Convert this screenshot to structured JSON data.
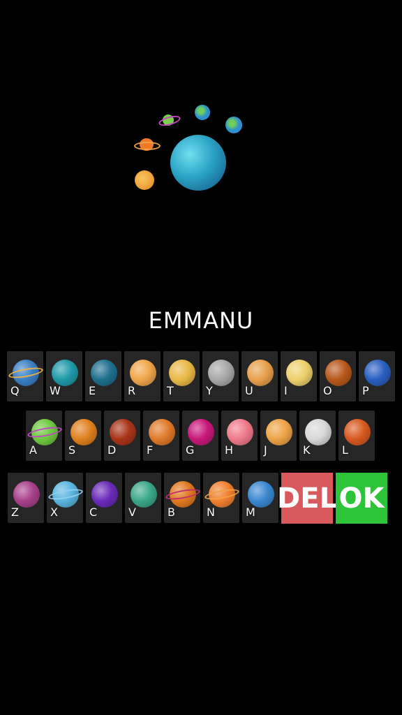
{
  "entered_name": "EMMANU",
  "scene_planets": [
    {
      "name": "large-blue-planet-icon",
      "color": "#2aa3c4"
    },
    {
      "name": "ringed-green-planet-icon",
      "color": "#7ccf4a"
    },
    {
      "name": "earth-small-1-icon",
      "color": "#2f8fd0"
    },
    {
      "name": "earth-small-2-icon",
      "color": "#2f8fd0"
    },
    {
      "name": "ringed-orange-planet-icon",
      "color": "#f07a2a"
    },
    {
      "name": "orange-planet-icon",
      "color": "#f2a640"
    }
  ],
  "keyboard": {
    "row1": [
      {
        "letter": "Q",
        "icon": "ringed-planet-icon",
        "color": "#3b7fc4",
        "ring": "#e9b04a"
      },
      {
        "letter": "W",
        "icon": "teal-planet-icon",
        "color": "#1f9aa8"
      },
      {
        "letter": "E",
        "icon": "blue-planet-icon",
        "color": "#1f6f8e"
      },
      {
        "letter": "R",
        "icon": "orange-moon-planet-icon",
        "color": "#f0a64a"
      },
      {
        "letter": "T",
        "icon": "yellow-striped-planet-icon",
        "color": "#e9b847"
      },
      {
        "letter": "Y",
        "icon": "gray-moon-icon",
        "color": "#a8a8a8"
      },
      {
        "letter": "U",
        "icon": "orange-blue-planet-icon",
        "color": "#e8a04c"
      },
      {
        "letter": "I",
        "icon": "yellow-planet-icon",
        "color": "#ecd06a"
      },
      {
        "letter": "O",
        "icon": "brown-cracked-planet-icon",
        "color": "#b8581c"
      },
      {
        "letter": "P",
        "icon": "deep-blue-planet-icon",
        "color": "#2a5fc0"
      }
    ],
    "row2": [
      {
        "letter": "A",
        "icon": "ringed-green-planet-icon",
        "color": "#6ec93f",
        "ring": "#c04ac0"
      },
      {
        "letter": "S",
        "icon": "orange-planet-icon",
        "color": "#e0801f"
      },
      {
        "letter": "D",
        "icon": "red-planet-icon",
        "color": "#a83418"
      },
      {
        "letter": "F",
        "icon": "orange-cracked-planet-icon",
        "color": "#e07a2a"
      },
      {
        "letter": "G",
        "icon": "magenta-planet-icon",
        "color": "#c8187a"
      },
      {
        "letter": "H",
        "icon": "pink-swirl-planet-icon",
        "color": "#f07a8a"
      },
      {
        "letter": "J",
        "icon": "orange-spotted-planet-icon",
        "color": "#eea446"
      },
      {
        "letter": "K",
        "icon": "white-rock-planet-icon",
        "color": "#d8d8d8"
      },
      {
        "letter": "L",
        "icon": "lava-planet-icon",
        "color": "#d85a20"
      }
    ],
    "row3": [
      {
        "letter": "Z",
        "icon": "purple-striped-planet-icon",
        "color": "#a8408a"
      },
      {
        "letter": "X",
        "icon": "ringed-blue-planet-icon",
        "color": "#5ab4e0",
        "ring": "#8fd0f0"
      },
      {
        "letter": "C",
        "icon": "purple-spotted-planet-icon",
        "color": "#6a2ab8"
      },
      {
        "letter": "V",
        "icon": "green-blue-planet-icon",
        "color": "#3aa88a"
      },
      {
        "letter": "B",
        "icon": "ringed-orange-striped-planet-icon",
        "color": "#e07a20",
        "ring": "#c0306a"
      },
      {
        "letter": "N",
        "icon": "ringed-orange-planet-icon",
        "color": "#f08030",
        "ring": "#f0a040"
      },
      {
        "letter": "M",
        "icon": "earth-planet-icon",
        "color": "#3a88d0"
      }
    ],
    "del_label": "DEL",
    "ok_label": "OK",
    "colors": {
      "key_bg": "#262626",
      "del": "#d95a5c",
      "ok": "#2dc43a"
    }
  }
}
